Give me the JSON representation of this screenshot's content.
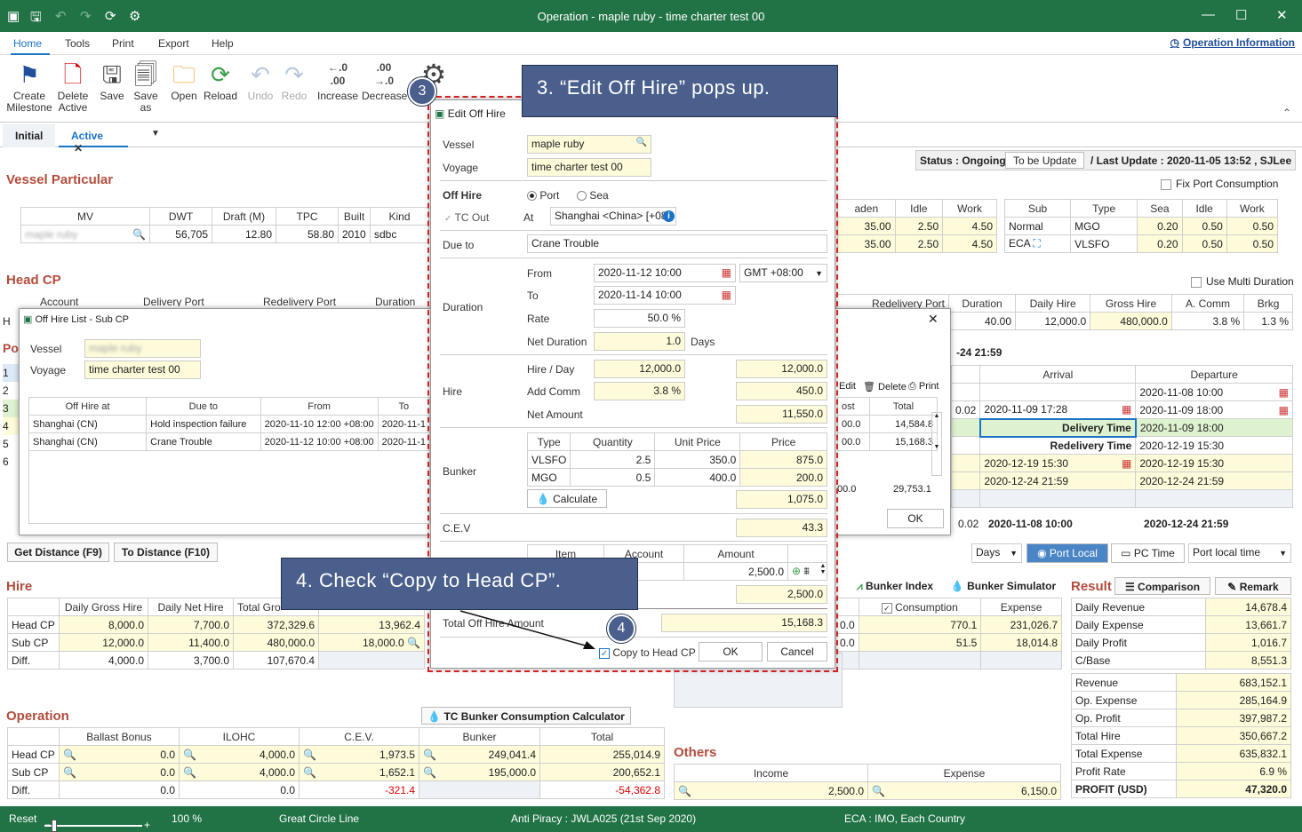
{
  "window": {
    "title": "Operation - maple ruby - time charter test 00"
  },
  "menu": {
    "home": "Home",
    "tools": "Tools",
    "print": "Print",
    "export": "Export",
    "help": "Help",
    "operation_info": "Operation Information"
  },
  "ribbon": {
    "create_milestone": [
      "Create",
      "Milestone"
    ],
    "delete_active": [
      "Delete",
      "Active"
    ],
    "save": "Save",
    "save_as": [
      "Save",
      "as"
    ],
    "open": "Open",
    "reload": "Reload",
    "undo": "Undo",
    "redo": "Redo",
    "increase": "Increase",
    "decrease": "Decrease",
    "increase_glyph": [
      ".0",
      ".00"
    ],
    "decrease_glyph": [
      ".00",
      ".0"
    ]
  },
  "tabs": {
    "initial": "Initial",
    "active": "Active"
  },
  "status": {
    "label": "Status : Ongoing",
    "to_be_update": "To be Update",
    "last_update": "/ Last Update : 2020-11-05 13:52 , SJLee",
    "fix_port_consumption": "Fix Port Consumption",
    "use_multi_duration": "Use Multi Duration"
  },
  "vessel_particular": {
    "title": "Vessel Particular",
    "headers": [
      "MV",
      "DWT",
      "Draft (M)",
      "TPC",
      "Built",
      "Kind"
    ],
    "row": [
      "maple ruby",
      "56,705",
      "12.80",
      "58.80",
      "2010",
      "sdbc"
    ]
  },
  "speed_table": {
    "headers": [
      "aden",
      "Idle",
      "Work"
    ],
    "rows": [
      [
        "35.00",
        "2.50",
        "4.50"
      ],
      [
        "35.00",
        "2.50",
        "4.50"
      ]
    ]
  },
  "fuel_table": {
    "headers": [
      "Sub",
      "Type",
      "Sea",
      "Idle",
      "Work"
    ],
    "rows": [
      [
        "Normal",
        "MGO",
        "0.20",
        "0.50",
        "0.50"
      ],
      [
        "ECA",
        "VLSFO",
        "0.20",
        "0.50",
        "0.50"
      ]
    ]
  },
  "head_cp": {
    "title": "Head CP",
    "headers": [
      "Account",
      "Delivery Port",
      "Redelivery Port",
      "Duration"
    ]
  },
  "cp_right": {
    "headers": [
      "Redelivery Port",
      "Duration",
      "Daily Hire",
      "Gross Hire",
      "A. Comm",
      "Brkg"
    ],
    "row": [
      "40.00",
      "12,000.0",
      "480,000.0",
      "3.8 %",
      "1.3 %"
    ]
  },
  "off_hire_list": {
    "title": "Off Hire List - Sub CP",
    "vessel_label": "Vessel",
    "vessel_value": "maple ruby",
    "voyage_label": "Voyage",
    "voyage_value": "time charter test 00",
    "headers": [
      "Off Hire at",
      "Due to",
      "From",
      "To"
    ],
    "rows": [
      [
        "Shanghai (CN)",
        "Hold inspection failure",
        "2020-11-10 12:00 +08:00",
        "2020-11-1"
      ],
      [
        "Shanghai (CN)",
        "Crane Trouble",
        "2020-11-12 10:00 +08:00",
        "2020-11-1"
      ]
    ],
    "edit": "Edit",
    "delete": "Delete",
    "print": "Print",
    "right_headers": [
      "ost",
      "Total"
    ],
    "right_rows": [
      [
        "00.0",
        "14,584.8"
      ],
      [
        "00.0",
        "15,168.3"
      ]
    ],
    "sum": [
      "00.0",
      "29,753.1"
    ],
    "ok": "OK"
  },
  "voyage_info": {
    "time": "-24 21:59",
    "headers": [
      "Arrival",
      "Departure"
    ],
    "rows": [
      [
        "",
        "",
        "2020-11-08 10:00"
      ],
      [
        "0.02",
        "2020-11-09 17:28",
        "2020-11-09 18:00"
      ],
      [
        "",
        "Delivery Time",
        "2020-11-09 18:00"
      ],
      [
        "",
        "Redelivery Time",
        "2020-12-19 15:30"
      ],
      [
        "",
        "2020-12-19 15:30",
        "2020-12-19 15:30"
      ],
      [
        "",
        "2020-12-24 21:59",
        "2020-12-24 21:59"
      ]
    ],
    "summary": [
      "0.02",
      "2020-11-08 10:00",
      "2020-12-24 21:59"
    ]
  },
  "left_row_markers": [
    "H",
    "Po",
    "1",
    "2",
    "3",
    "4",
    "5",
    "6"
  ],
  "distance": {
    "get": "Get Distance (F9)",
    "to": "To Distance (F10)"
  },
  "time_controls": {
    "days": "Days",
    "port_local": "Port Local",
    "pc_time": "PC Time",
    "port_local_time": "Port local time"
  },
  "hire": {
    "title": "Hire",
    "headers": [
      "",
      "Daily Gross Hire",
      "Daily Net Hire",
      "Total Gro"
    ],
    "rows": [
      [
        "Head CP",
        "8,000.0",
        "7,700.0",
        "372,329.6",
        "13,962.4"
      ],
      [
        "Sub CP",
        "12,000.0",
        "11,400.0",
        "480,000.0",
        "18,000.0"
      ],
      [
        "Diff.",
        "4,000.0",
        "3,700.0",
        "107,670.4",
        ""
      ]
    ]
  },
  "bunker_mid": {
    "bunker_index": "Bunker Index",
    "bunker_simulator": "Bunker Simulator",
    "headers": [
      "Consumption",
      "Expense"
    ],
    "rows": [
      [
        "0.0",
        "770.1",
        "231,026.7"
      ],
      [
        "0.0",
        "51.5",
        "18,014.8"
      ]
    ]
  },
  "result": {
    "title": "Result",
    "comparison": "Comparison",
    "remark": "Remark",
    "rows1": [
      [
        "Daily Revenue",
        "14,678.4"
      ],
      [
        "Daily Expense",
        "13,661.7"
      ],
      [
        "Daily Profit",
        "1,016.7"
      ],
      [
        "C/Base",
        "8,551.3"
      ]
    ],
    "rows2": [
      [
        "Revenue",
        "683,152.1"
      ],
      [
        "Op. Expense",
        "285,164.9"
      ],
      [
        "Op. Profit",
        "397,987.2"
      ],
      [
        "Total Hire",
        "350,667.2"
      ],
      [
        "Total Expense",
        "635,832.1"
      ],
      [
        "Profit Rate",
        "6.9 %"
      ],
      [
        "PROFIT (USD)",
        "47,320.0"
      ]
    ]
  },
  "operation": {
    "title": "Operation",
    "tc_calc": "TC Bunker Consumption Calculator",
    "headers": [
      "",
      "Ballast Bonus",
      "ILOHC",
      "C.E.V.",
      "Bunker",
      "Total"
    ],
    "rows": [
      [
        "Head CP",
        "0.0",
        "4,000.0",
        "1,973.5",
        "249,041.4",
        "255,014.9"
      ],
      [
        "Sub CP",
        "0.0",
        "4,000.0",
        "1,652.1",
        "195,000.0",
        "200,652.1"
      ],
      [
        "Diff.",
        "0.0",
        "0.0",
        "-321.4",
        "",
        "-54,362.8"
      ]
    ]
  },
  "others": {
    "title": "Others",
    "headers": [
      "Income",
      "Expense"
    ],
    "row": [
      "2,500.0",
      "6,150.0"
    ]
  },
  "edit_off_hire": {
    "title": "Edit Off Hire",
    "vessel_label": "Vessel",
    "vessel": "maple ruby",
    "voyage_label": "Voyage",
    "voyage": "time charter test 00",
    "off_hire_label": "Off Hire",
    "port": "Port",
    "sea": "Sea",
    "tc_out": "TC Out",
    "at": "At",
    "at_value": "Shanghai <China> [+08",
    "due_to_label": "Due to",
    "due_to": "Crane Trouble",
    "duration_label": "Duration",
    "from_label": "From",
    "from": "2020-11-12 10:00",
    "gmt": "GMT +08:00",
    "to_label": "To",
    "to": "2020-11-14 10:00",
    "rate_label": "Rate",
    "rate": "50.0 %",
    "net_duration_label": "Net Duration",
    "net_duration": "1.0",
    "days": "Days",
    "hire_label": "Hire",
    "hire_day_label": "Hire / Day",
    "hire_day": "12,000.0",
    "hire_day_total": "12,000.0",
    "add_comm_label": "Add Comm",
    "add_comm": "3.8 %",
    "add_comm_total": "450.0",
    "net_amount_label": "Net Amount",
    "net_amount": "11,550.0",
    "bunker_label": "Bunker",
    "bunker_headers": [
      "Type",
      "Quantity",
      "Unit Price",
      "Price"
    ],
    "bunker_rows": [
      [
        "VLSFO",
        "2.5",
        "350.0",
        "875.0"
      ],
      [
        "MGO",
        "0.5",
        "400.0",
        "200.0"
      ]
    ],
    "calculate": "Calculate",
    "bunker_total": "1,075.0",
    "cev_label": "C.E.V",
    "cev": "43.3",
    "item_headers": [
      "Item",
      "Account",
      "Amount"
    ],
    "item_amount": "2,500.0",
    "item_total": "2,500.0",
    "total_label": "Total Off Hire Amount",
    "total": "15,168.3",
    "copy_to_head_cp": "Copy to Head CP",
    "ok": "OK",
    "cancel": "Cancel"
  },
  "callouts": {
    "c3": "3. “Edit Off Hire” pops up.",
    "c4": "4. Check “Copy to Head CP”.",
    "b3": "3",
    "b4": "4"
  },
  "statusbar": {
    "reset": "Reset",
    "zoom": "100 %",
    "great_circle": "Great Circle Line",
    "anti_piracy": "Anti Piracy : JWLA025 (21st Sep 2020)",
    "eca": "ECA : IMO, Each Country"
  },
  "colors": {
    "brand_green": "#217346",
    "callout": "#4a5f8c",
    "section_title": "#b34c3c",
    "input_yellow": "#fdfbd9"
  }
}
